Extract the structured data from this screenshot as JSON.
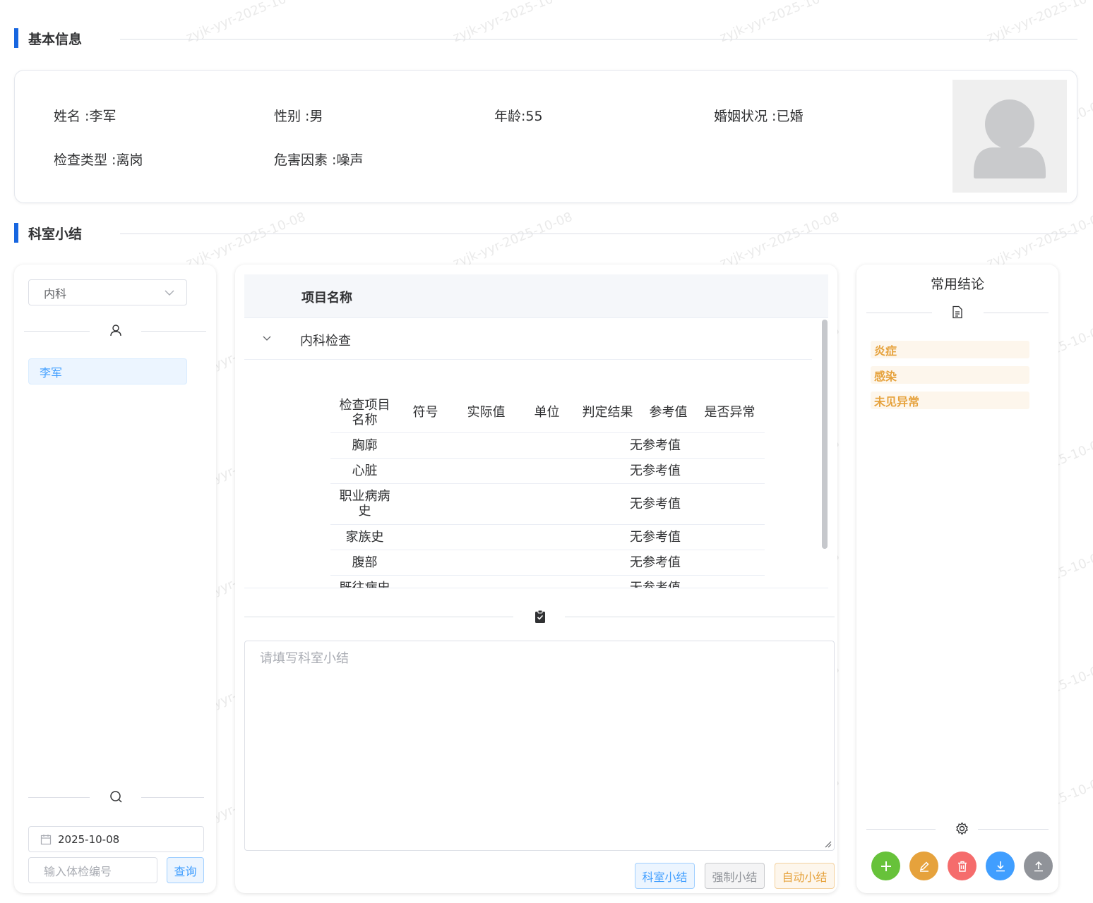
{
  "sections": {
    "basic_info": "基本信息",
    "dept_summary": "科室小结"
  },
  "patient": {
    "name": "姓名 :李军",
    "gender": "性别 :男",
    "age": "年龄:55",
    "marital": "婚姻状况 :已婚",
    "exam_type": "检查类型 :离岗",
    "hazard": "危害因素 :噪声"
  },
  "left_panel": {
    "department": "内科",
    "person": "李军",
    "date": "2025-10-08",
    "exam_no_placeholder": "输入体检编号",
    "query_label": "查询"
  },
  "main_table": {
    "header": "项目名称",
    "group": "内科检查",
    "columns": [
      "检查项目名称",
      "符号",
      "实际值",
      "单位",
      "判定结果",
      "参考值",
      "是否异常"
    ],
    "rows": [
      {
        "name": "胸廓",
        "ref": "无参考值"
      },
      {
        "name": "心脏",
        "ref": "无参考值"
      },
      {
        "name": "职业病病史",
        "ref": "无参考值"
      },
      {
        "name": "家族史",
        "ref": "无参考值"
      },
      {
        "name": "腹部",
        "ref": "无参考值"
      },
      {
        "name": "既往病史",
        "ref": "无参考值"
      }
    ]
  },
  "summary": {
    "placeholder": "请填写科室小结",
    "btn_dept": "科室小结",
    "btn_force": "强制小结",
    "btn_auto": "自动小结"
  },
  "right_panel": {
    "title": "常用结论",
    "tags": [
      "炎症",
      "感染",
      "未见异常"
    ]
  },
  "watermark_text": "zyjk-yyr-2025-10-08",
  "colors": {
    "accent": "#1766e0",
    "primary": "#409eff",
    "success": "#67c23a",
    "warning": "#e6a23c",
    "danger": "#f56c6c",
    "info": "#909399"
  },
  "icons": {
    "person": "user-icon",
    "search": "search-icon",
    "calendar": "calendar-icon",
    "document": "document-icon",
    "clipboard": "clipboard-check-icon",
    "settings": "gear-icon",
    "add": "plus-icon",
    "edit": "edit-icon",
    "delete": "trash-icon",
    "download": "download-icon",
    "upload": "upload-icon"
  }
}
